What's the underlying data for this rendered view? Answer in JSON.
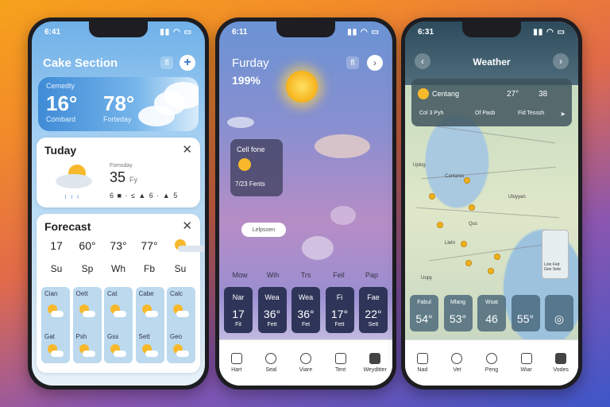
{
  "phone1": {
    "time": "6:41",
    "title": "Cake Section",
    "header_icon": "fl",
    "hero": {
      "small": "Cemedty",
      "temp1": "16°",
      "temp2": "78°",
      "label1": "Combard",
      "label2": "Forteday"
    },
    "today": {
      "title": "Tuday",
      "small": "Fomsday",
      "big": "35",
      "unit": "Fy",
      "row": "6 ■ · ≤ ▲ 6 · ▲ 5"
    },
    "forecast": {
      "title": "Forecast",
      "temps": [
        "17",
        "60°",
        "73°",
        "77°",
        ""
      ],
      "days": [
        "Su",
        "Sp",
        "Wh",
        "Fb",
        "Su"
      ],
      "cols": [
        {
          "a": "Cian",
          "b": "Gat"
        },
        {
          "a": "Oett",
          "b": "Psh"
        },
        {
          "a": "Cat",
          "b": "Gss"
        },
        {
          "a": "Cabe",
          "b": "Sett"
        },
        {
          "a": "Calc",
          "b": "Geo"
        }
      ]
    }
  },
  "phone2": {
    "time": "6:11",
    "title": "Furday",
    "subtitle": "199%",
    "header_icon": "fl",
    "mini_card": {
      "title": "Cell fone",
      "value": "7/23 Fents"
    },
    "pill": "Lelpsoen",
    "days": [
      "Mow",
      "Wih",
      "Trs",
      "Feil",
      "Pap"
    ],
    "tiles": [
      {
        "a": "Nar",
        "b": "17",
        "c": "Fit"
      },
      {
        "a": "Wea",
        "b": "36°",
        "c": "Fett"
      },
      {
        "a": "Wea",
        "b": "36°",
        "c": "Fet"
      },
      {
        "a": "Fi",
        "b": "17°",
        "c": "Fett"
      },
      {
        "a": "Fae",
        "b": "22°",
        "c": "Sett"
      }
    ],
    "nav": [
      "Hart",
      "Seal",
      "Viare",
      "Tent",
      "Weyditter"
    ]
  },
  "phone3": {
    "time": "6:31",
    "title": "Weather",
    "panel": {
      "label": "Centang",
      "v1": "27°",
      "v2": "38",
      "r2a": "Col 3 Pyh",
      "r2b": "Of Pasb",
      "r2c": "Fid Tesssh"
    },
    "map_labels": [
      "Uplog",
      "Cantaras",
      "Uloyyan",
      "Qus",
      "Lletn",
      "Uopy"
    ],
    "legend": "Lolo Fed Gee Sete",
    "tiles": [
      {
        "a": "Fabul",
        "b": "54°"
      },
      {
        "a": "Mlang",
        "b": "53°"
      },
      {
        "a": "Wsat",
        "b": "46"
      },
      {
        "a": "",
        "b": "55°"
      },
      {
        "a": "",
        "b": "◎"
      }
    ],
    "nav": [
      "Nad",
      "Vet",
      "Peng",
      "Wiar",
      "Vodes"
    ]
  }
}
